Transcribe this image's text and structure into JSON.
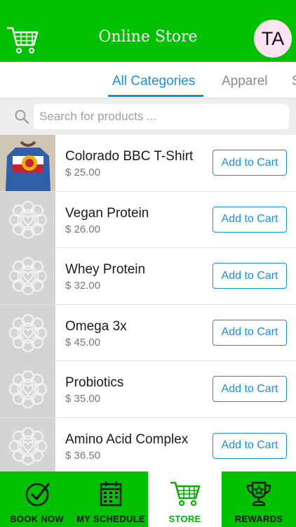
{
  "header": {
    "title": "Online Store",
    "avatar_initials": "TA",
    "cart_icon": "shopping-cart-icon"
  },
  "tabs": [
    {
      "label": "All Categories",
      "active": true
    },
    {
      "label": "Apparel",
      "active": false
    },
    {
      "label": "S",
      "active": false
    }
  ],
  "search": {
    "placeholder": "Search for products ...",
    "value": ""
  },
  "products": [
    {
      "name": "Colorado BBC T-Shirt",
      "price": "$ 25.00",
      "button": "Add to Cart",
      "image": "t-shirt-photo"
    },
    {
      "name": "Vegan Protein",
      "price": "$ 26.00",
      "button": "Add to Cart",
      "image": "placeholder-logo"
    },
    {
      "name": "Whey Protein",
      "price": "$ 32.00",
      "button": "Add to Cart",
      "image": "placeholder-logo"
    },
    {
      "name": "Omega 3x",
      "price": "$ 45.00",
      "button": "Add to Cart",
      "image": "placeholder-logo"
    },
    {
      "name": "Probiotics",
      "price": "$ 35.00",
      "button": "Add to Cart",
      "image": "placeholder-logo"
    },
    {
      "name": "Amino Acid Complex",
      "price": "$ 36.50",
      "button": "Add to Cart",
      "image": "placeholder-logo"
    }
  ],
  "tabbar": [
    {
      "label": "BOOK NOW",
      "icon": "checkmark-circle-icon",
      "active": false
    },
    {
      "label": "MY SCHEDULE",
      "icon": "calendar-icon",
      "active": false
    },
    {
      "label": "STORE",
      "icon": "shopping-cart-icon",
      "active": true
    },
    {
      "label": "REWARDS",
      "icon": "trophy-icon",
      "active": false
    }
  ],
  "colors": {
    "brand_green": "#00c000",
    "accent_blue": "#1a8fd6",
    "avatar_bg": "#fbe3ef"
  }
}
